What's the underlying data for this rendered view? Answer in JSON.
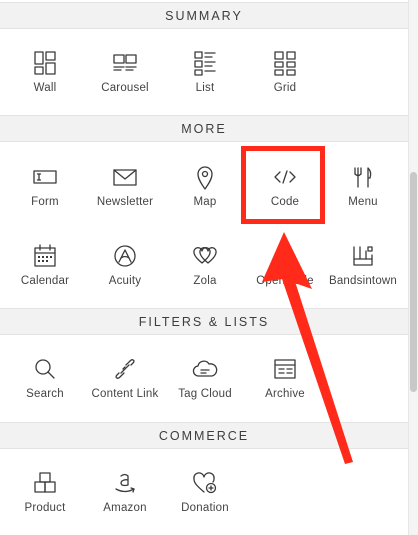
{
  "sections": {
    "summary": "SUMMARY",
    "more": "MORE",
    "filters": "FILTERS & LISTS",
    "commerce": "COMMERCE"
  },
  "summary_items": [
    {
      "label": "Wall",
      "icon": "wall-icon"
    },
    {
      "label": "Carousel",
      "icon": "carousel-icon"
    },
    {
      "label": "List",
      "icon": "list-icon"
    },
    {
      "label": "Grid",
      "icon": "grid-icon"
    }
  ],
  "more_items": [
    {
      "label": "Form",
      "icon": "form-icon"
    },
    {
      "label": "Newsletter",
      "icon": "envelope-icon"
    },
    {
      "label": "Map",
      "icon": "map-pin-icon"
    },
    {
      "label": "Code",
      "icon": "code-icon"
    },
    {
      "label": "Menu",
      "icon": "fork-knife-icon"
    },
    {
      "label": "Calendar",
      "icon": "calendar-icon"
    },
    {
      "label": "Acuity",
      "icon": "acuity-icon"
    },
    {
      "label": "Zola",
      "icon": "zola-hearts-icon"
    },
    {
      "label": "OpenTable",
      "icon": "opentable-icon"
    },
    {
      "label": "Bandsintown",
      "icon": "bandsintown-icon"
    }
  ],
  "filters_items": [
    {
      "label": "Search",
      "icon": "search-icon"
    },
    {
      "label": "Content Link",
      "icon": "link-icon"
    },
    {
      "label": "Tag Cloud",
      "icon": "tag-cloud-icon"
    },
    {
      "label": "Archive",
      "icon": "archive-icon"
    }
  ],
  "commerce_items": [
    {
      "label": "Product",
      "icon": "product-boxes-icon"
    },
    {
      "label": "Amazon",
      "icon": "amazon-icon"
    },
    {
      "label": "Donation",
      "icon": "donation-heart-icon"
    }
  ],
  "annotation": {
    "color": "#ff2a1a",
    "highlighted": "Code"
  }
}
